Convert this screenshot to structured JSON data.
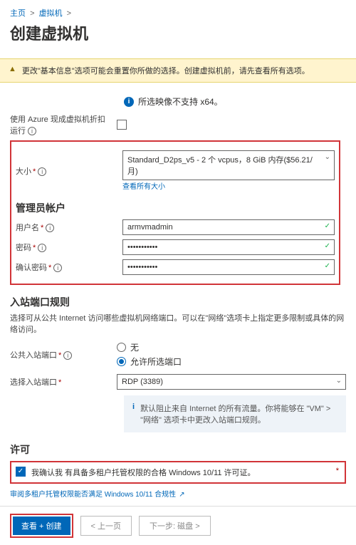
{
  "breadcrumb": {
    "home": "主页",
    "sep": ">",
    "vm": "虚拟机",
    "sep2": ">"
  },
  "title": "创建虚拟机",
  "warning": "更改\"基本信息\"选项可能会重置你所做的选择。创建虚拟机前，请先查看所有选项。",
  "x64_msg": "所选映像不支持 x64。",
  "labels": {
    "azure": "使用 Azure 现成虚拟机折扣运行",
    "size": "大小",
    "admin_section": "管理员帐户",
    "username": "用户名",
    "password": "密码",
    "confirm_pwd": "确认密码",
    "ports_section": "入站端口规则",
    "ports_desc": "选择可从公共 Internet 访问哪些虚拟机网络端口。可以在\"网络\"选项卡上指定更多限制或具体的网络访问。",
    "public_ports": "公共入站端口",
    "select_ports": "选择入站端口",
    "license_section": "许可"
  },
  "fields": {
    "size_value": "Standard_D2ps_v5 - 2 个 vcpus，8 GiB 内存($56.21/月)",
    "size_link": "查看所有大小",
    "username_value": "armvmadmin",
    "password_value": "•••••••••••",
    "confirm_value": "•••••••••••",
    "radio_none": "无",
    "radio_allow": "允许所选端口",
    "rdp_value": "RDP (3389)"
  },
  "note_text": "默认阻止来自 Internet 的所有流量。你将能够在 \"VM\" > \"网络\" 选项卡中更改入站端口规则。",
  "license": {
    "checkbox_text": "我确认我 有具备多租户托管权限的合格 Windows 10/11 许可证。",
    "link": "审阅多租户托管权限能否满足 Windows 10/11 合规性"
  },
  "footer": {
    "review": "查看 + 创建",
    "prev": "< 上一页",
    "next": "下一步: 磁盘 >"
  }
}
